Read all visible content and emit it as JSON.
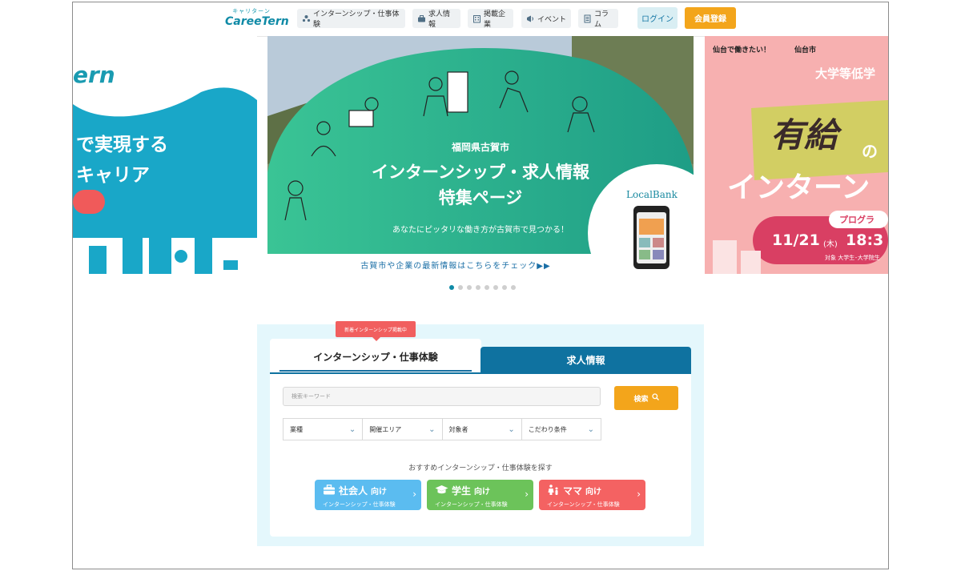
{
  "header": {
    "logo_kana": "キャリターン",
    "logo_text": "CareeTern",
    "nav": [
      {
        "label": "インターンシップ・仕事体験",
        "icon": "people-icon"
      },
      {
        "label": "求人情報",
        "icon": "briefcase-icon"
      },
      {
        "label": "掲載企業",
        "icon": "building-icon"
      },
      {
        "label": "イベント",
        "icon": "megaphone-icon"
      },
      {
        "label": "コラム",
        "icon": "document-icon"
      }
    ],
    "login": "ログイン",
    "register": "会員登録"
  },
  "carousel": {
    "left": {
      "brand_fragment": "ern",
      "line1": "で実現する",
      "line2": "キャリア"
    },
    "center": {
      "city": "福岡県古賀市",
      "title1": "インターンシップ・求人情報",
      "title2": "特集ページ",
      "tagline": "あなたにピッタリな働き方が古賀市で見つかる！",
      "brand": "LocalBank",
      "footer": "古賀市や企業の最新情報はこちらをチェック▶▶"
    },
    "right": {
      "header": "仙台で働きたい！",
      "city": "仙台市",
      "subtitle": "大学等低学",
      "big1": "有給",
      "no": "の",
      "big2": "インターン",
      "program": "プログラ",
      "date": "11/21",
      "weekday": "(木)",
      "time": "18:3",
      "target": "対象 大学生･大学院生"
    },
    "dots": 8,
    "active_dot": 0
  },
  "search": {
    "badge": "新着インターンシップ掲載中",
    "tab_internship": "インターンシップ・仕事体験",
    "tab_jobs": "求人情報",
    "keyword_placeholder": "検索キーワード",
    "search_button": "検索",
    "filters": [
      "業種",
      "開催エリア",
      "対象者",
      "こだわり条件"
    ],
    "recommend_title": "おすすめインターンシップ・仕事体験を探す",
    "recommend": [
      {
        "title": "社会人",
        "suffix": "向け",
        "sub": "インターンシップ・仕事体験",
        "color": "#5bbcf0",
        "icon": "briefcase-icon"
      },
      {
        "title": "学生",
        "suffix": "向け",
        "sub": "インターンシップ・仕事体験",
        "color": "#6cc35a",
        "icon": "graduation-cap-icon"
      },
      {
        "title": "ママ",
        "suffix": "向け",
        "sub": "インターンシップ・仕事体験",
        "color": "#f46262",
        "icon": "parent-child-icon"
      }
    ]
  },
  "colors": {
    "accent": "#0f8aa6",
    "orange": "#f3a51b",
    "tab_blue": "#0f72a0",
    "panel_bg": "#e4f7fc"
  }
}
